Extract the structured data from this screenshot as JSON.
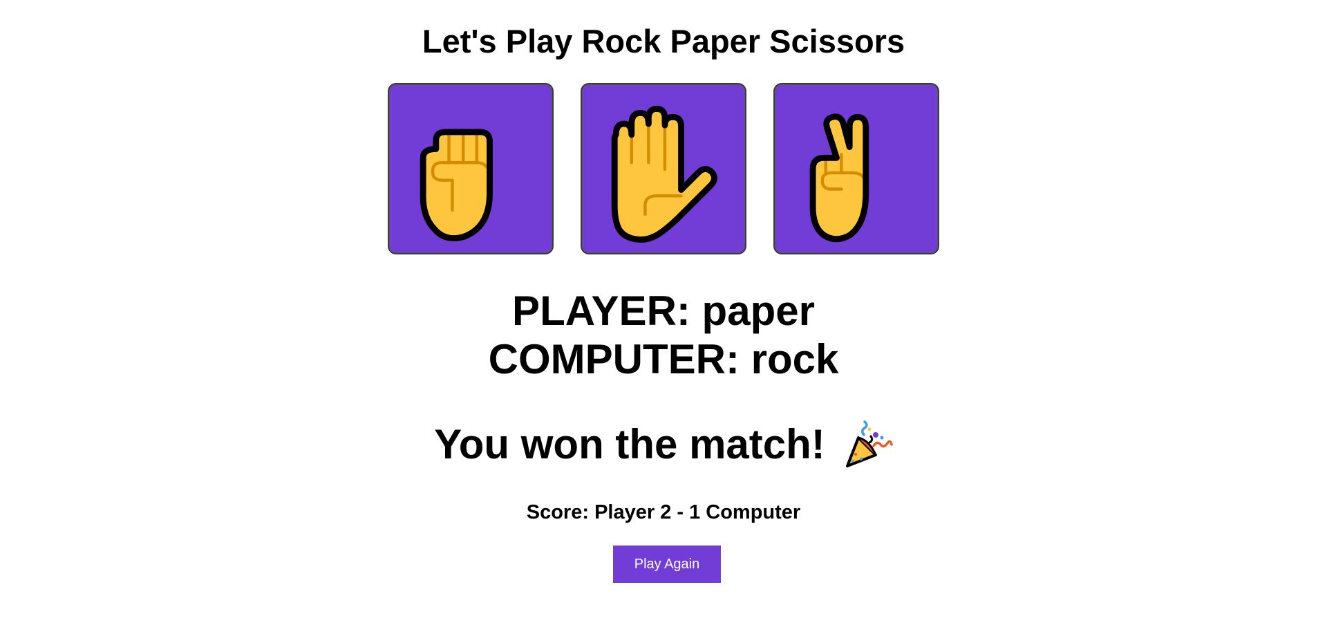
{
  "title": "Let's Play Rock Paper Scissors",
  "choices": [
    {
      "name": "rock",
      "icon": "raised-fist-icon"
    },
    {
      "name": "paper",
      "icon": "raised-hand-icon"
    },
    {
      "name": "scissors",
      "icon": "victory-hand-icon"
    }
  ],
  "result": {
    "player_line": "PLAYER: paper",
    "computer_line": "COMPUTER: rock"
  },
  "outcome": {
    "message": "You won the match!",
    "icon": "party-popper-icon"
  },
  "score": {
    "text": "Score: Player 2 - 1 Computer"
  },
  "play_again_label": "Play Again",
  "colors": {
    "accent": "#723CD6",
    "hand": "#FEC63E",
    "hand_line": "#D48D00",
    "outline": "#000000"
  }
}
